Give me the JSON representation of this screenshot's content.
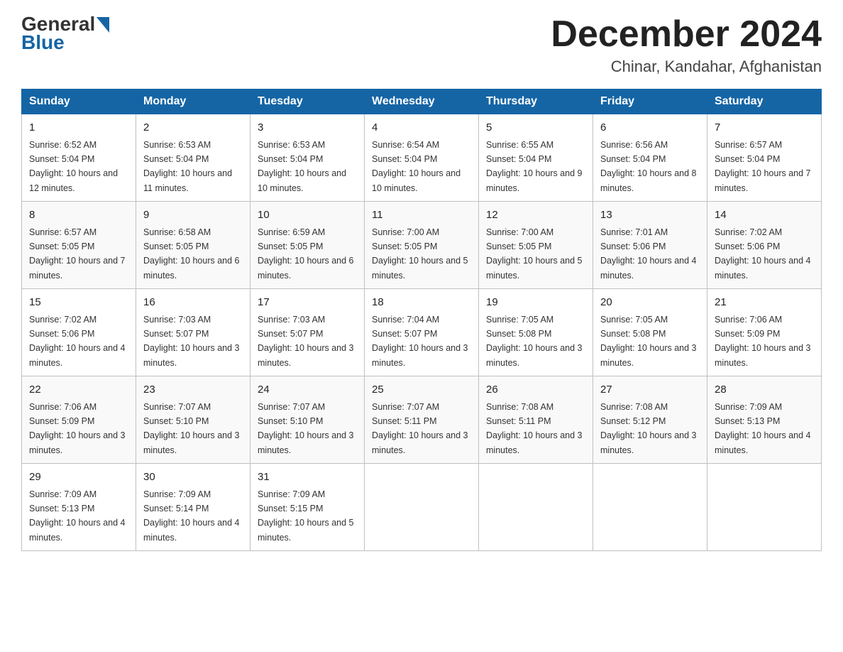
{
  "header": {
    "logo_general": "General",
    "logo_blue": "Blue",
    "month_title": "December 2024",
    "location": "Chinar, Kandahar, Afghanistan"
  },
  "days_of_week": [
    "Sunday",
    "Monday",
    "Tuesday",
    "Wednesday",
    "Thursday",
    "Friday",
    "Saturday"
  ],
  "weeks": [
    [
      {
        "num": "1",
        "sunrise": "6:52 AM",
        "sunset": "5:04 PM",
        "daylight": "10 hours and 12 minutes."
      },
      {
        "num": "2",
        "sunrise": "6:53 AM",
        "sunset": "5:04 PM",
        "daylight": "10 hours and 11 minutes."
      },
      {
        "num": "3",
        "sunrise": "6:53 AM",
        "sunset": "5:04 PM",
        "daylight": "10 hours and 10 minutes."
      },
      {
        "num": "4",
        "sunrise": "6:54 AM",
        "sunset": "5:04 PM",
        "daylight": "10 hours and 10 minutes."
      },
      {
        "num": "5",
        "sunrise": "6:55 AM",
        "sunset": "5:04 PM",
        "daylight": "10 hours and 9 minutes."
      },
      {
        "num": "6",
        "sunrise": "6:56 AM",
        "sunset": "5:04 PM",
        "daylight": "10 hours and 8 minutes."
      },
      {
        "num": "7",
        "sunrise": "6:57 AM",
        "sunset": "5:04 PM",
        "daylight": "10 hours and 7 minutes."
      }
    ],
    [
      {
        "num": "8",
        "sunrise": "6:57 AM",
        "sunset": "5:05 PM",
        "daylight": "10 hours and 7 minutes."
      },
      {
        "num": "9",
        "sunrise": "6:58 AM",
        "sunset": "5:05 PM",
        "daylight": "10 hours and 6 minutes."
      },
      {
        "num": "10",
        "sunrise": "6:59 AM",
        "sunset": "5:05 PM",
        "daylight": "10 hours and 6 minutes."
      },
      {
        "num": "11",
        "sunrise": "7:00 AM",
        "sunset": "5:05 PM",
        "daylight": "10 hours and 5 minutes."
      },
      {
        "num": "12",
        "sunrise": "7:00 AM",
        "sunset": "5:05 PM",
        "daylight": "10 hours and 5 minutes."
      },
      {
        "num": "13",
        "sunrise": "7:01 AM",
        "sunset": "5:06 PM",
        "daylight": "10 hours and 4 minutes."
      },
      {
        "num": "14",
        "sunrise": "7:02 AM",
        "sunset": "5:06 PM",
        "daylight": "10 hours and 4 minutes."
      }
    ],
    [
      {
        "num": "15",
        "sunrise": "7:02 AM",
        "sunset": "5:06 PM",
        "daylight": "10 hours and 4 minutes."
      },
      {
        "num": "16",
        "sunrise": "7:03 AM",
        "sunset": "5:07 PM",
        "daylight": "10 hours and 3 minutes."
      },
      {
        "num": "17",
        "sunrise": "7:03 AM",
        "sunset": "5:07 PM",
        "daylight": "10 hours and 3 minutes."
      },
      {
        "num": "18",
        "sunrise": "7:04 AM",
        "sunset": "5:07 PM",
        "daylight": "10 hours and 3 minutes."
      },
      {
        "num": "19",
        "sunrise": "7:05 AM",
        "sunset": "5:08 PM",
        "daylight": "10 hours and 3 minutes."
      },
      {
        "num": "20",
        "sunrise": "7:05 AM",
        "sunset": "5:08 PM",
        "daylight": "10 hours and 3 minutes."
      },
      {
        "num": "21",
        "sunrise": "7:06 AM",
        "sunset": "5:09 PM",
        "daylight": "10 hours and 3 minutes."
      }
    ],
    [
      {
        "num": "22",
        "sunrise": "7:06 AM",
        "sunset": "5:09 PM",
        "daylight": "10 hours and 3 minutes."
      },
      {
        "num": "23",
        "sunrise": "7:07 AM",
        "sunset": "5:10 PM",
        "daylight": "10 hours and 3 minutes."
      },
      {
        "num": "24",
        "sunrise": "7:07 AM",
        "sunset": "5:10 PM",
        "daylight": "10 hours and 3 minutes."
      },
      {
        "num": "25",
        "sunrise": "7:07 AM",
        "sunset": "5:11 PM",
        "daylight": "10 hours and 3 minutes."
      },
      {
        "num": "26",
        "sunrise": "7:08 AM",
        "sunset": "5:11 PM",
        "daylight": "10 hours and 3 minutes."
      },
      {
        "num": "27",
        "sunrise": "7:08 AM",
        "sunset": "5:12 PM",
        "daylight": "10 hours and 3 minutes."
      },
      {
        "num": "28",
        "sunrise": "7:09 AM",
        "sunset": "5:13 PM",
        "daylight": "10 hours and 4 minutes."
      }
    ],
    [
      {
        "num": "29",
        "sunrise": "7:09 AM",
        "sunset": "5:13 PM",
        "daylight": "10 hours and 4 minutes."
      },
      {
        "num": "30",
        "sunrise": "7:09 AM",
        "sunset": "5:14 PM",
        "daylight": "10 hours and 4 minutes."
      },
      {
        "num": "31",
        "sunrise": "7:09 AM",
        "sunset": "5:15 PM",
        "daylight": "10 hours and 5 minutes."
      },
      null,
      null,
      null,
      null
    ]
  ],
  "labels": {
    "sunrise_prefix": "Sunrise: ",
    "sunset_prefix": "Sunset: ",
    "daylight_prefix": "Daylight: "
  }
}
